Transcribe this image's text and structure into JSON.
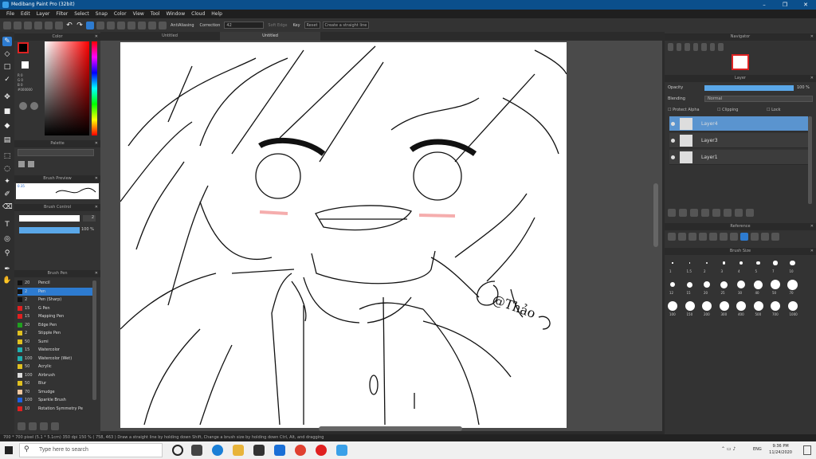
{
  "window": {
    "title": "Medibang Paint Pro (32bit)",
    "minimize": "–",
    "maximize": "❐",
    "close": "✕"
  },
  "menu": [
    "File",
    "Edit",
    "Layer",
    "Filter",
    "Select",
    "Snap",
    "Color",
    "View",
    "Tool",
    "Window",
    "Cloud",
    "Help"
  ],
  "toolbar": {
    "antialias": "AntiAliasing",
    "correction_label": "Correction",
    "correction_value": "42",
    "soft_edge": "Soft Edge",
    "key": "Key",
    "reset": "Reset",
    "straight": "Create a straight line"
  },
  "tabs": [
    "Untitled",
    "Untitled"
  ],
  "panels": {
    "color": "Color",
    "color_values": {
      "r": "R 0",
      "g": "G 0",
      "b": "B 0",
      "hex": "#000000"
    },
    "palette": "Palette",
    "brush_preview": "Brush Preview",
    "brush_preview_size": "0.35",
    "brush_control": "Brush Control",
    "brush_size_value": "2",
    "brush_opacity": "100 %",
    "brush_pen": "Brush Pen",
    "navigator": "Navigator",
    "layer": "Layer",
    "reference": "Reference",
    "brush_size": "Brush Size"
  },
  "layer_panel": {
    "opacity_label": "Opacity",
    "opacity_value": "100 %",
    "opacity_fraction": 1.0,
    "blending_label": "Blending",
    "blending_value": "Normal",
    "protect_alpha": "Protect Alpha",
    "clipping": "Clipping",
    "lock": "Lock",
    "layers": [
      {
        "name": "Layer4",
        "selected": true
      },
      {
        "name": "Layer3",
        "selected": false
      },
      {
        "name": "Layer1",
        "selected": false
      }
    ]
  },
  "brushes": [
    {
      "size": "20",
      "name": "Pencil",
      "color": "#111111"
    },
    {
      "size": "2",
      "name": "Pen",
      "color": "#111111",
      "selected": true
    },
    {
      "size": "2",
      "name": "Pen (Sharp)",
      "color": "#111111"
    },
    {
      "size": "15",
      "name": "G Pen",
      "color": "#e02020"
    },
    {
      "size": "15",
      "name": "Mapping Pen",
      "color": "#e02020"
    },
    {
      "size": "20",
      "name": "Edge Pen",
      "color": "#20a020"
    },
    {
      "size": "2",
      "name": "Stipple Pen",
      "color": "#e0c020"
    },
    {
      "size": "50",
      "name": "Sumi",
      "color": "#e0c020"
    },
    {
      "size": "15",
      "name": "Watercolor",
      "color": "#20b0b0"
    },
    {
      "size": "100",
      "name": "Watercolor (Wet)",
      "color": "#20b0b0"
    },
    {
      "size": "50",
      "name": "Acrylic",
      "color": "#e0c020"
    },
    {
      "size": "100",
      "name": "Airbrush",
      "color": "#dddddd"
    },
    {
      "size": "50",
      "name": "Blur",
      "color": "#e0c020"
    },
    {
      "size": "70",
      "name": "Smudge",
      "color": "#f0c8a0"
    },
    {
      "size": "100",
      "name": "Sparkle Brush",
      "color": "#2060e0"
    },
    {
      "size": "10",
      "name": "Rotation Symmetry Pe",
      "color": "#e02020"
    }
  ],
  "brush_sizes_row1": [
    "1",
    "1.5",
    "2",
    "3",
    "4",
    "5",
    "7",
    "10"
  ],
  "brush_sizes_row2": [
    "12",
    "15",
    "20",
    "25",
    "30",
    "40",
    "50",
    "70"
  ],
  "brush_sizes_row3": [
    "100",
    "150",
    "200",
    "300",
    "400",
    "500",
    "700",
    "1000"
  ],
  "status": "700 * 700 pixel  (5.1 * 5.1cm)  350 dpi  150 %  ( 758, 463 )  Draw a straight line by holding down Shift, Change a brush size by holding down Ctrl, Alt, and dragging",
  "taskbar": {
    "search_placeholder": "Type here to search",
    "time": "9:36 PM",
    "date": "11/24/2020",
    "lang": "ENG"
  },
  "signature": "@Thảo"
}
